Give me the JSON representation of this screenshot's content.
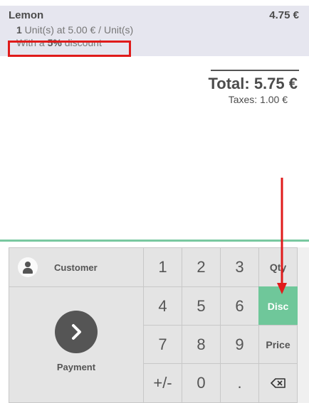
{
  "order": {
    "line": {
      "product": "Lemon",
      "price": "4.75 €",
      "qty": "1",
      "unit_text": " Unit(s) at 5.00 € / Unit(s)",
      "disc_prefix": "With a ",
      "disc_value": "5%",
      "disc_suffix": " discount"
    },
    "total": "Total: 5.75 €",
    "taxes": "Taxes: 1.00 €"
  },
  "pad": {
    "customer_label": "Customer",
    "payment_label": "Payment",
    "digits": [
      "1",
      "2",
      "3",
      "4",
      "5",
      "6",
      "7",
      "8",
      "9"
    ],
    "plusminus": "+/-",
    "zero": "0",
    "dot": ".",
    "modes": {
      "qty": "Qty",
      "disc": "Disc",
      "price": "Price"
    },
    "active_mode": "disc",
    "backspace_icon": "backspace-icon"
  },
  "annotations": {
    "highlight_color": "#e01b1b",
    "arrow_color": "#e01b1b"
  },
  "colors": {
    "accent": "#6fc79a",
    "line_bg": "#e6e6ef"
  }
}
